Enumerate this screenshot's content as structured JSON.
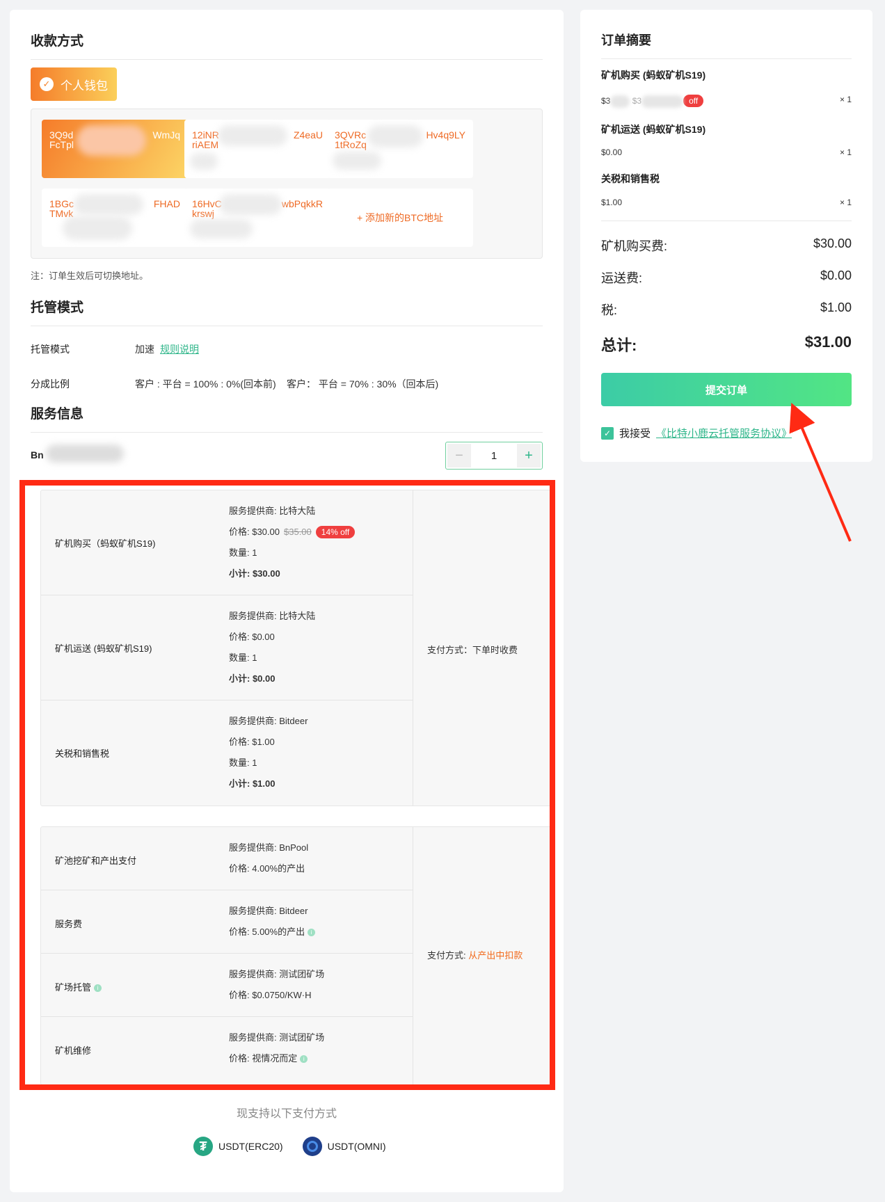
{
  "payment_method": {
    "title": "收款方式",
    "wallet_tab": "个人钱包",
    "addresses": [
      {
        "line1": "3Q9d",
        "line1_end": "WmJq",
        "line2": "FcTpl"
      },
      {
        "line1": "12iNR",
        "line1_end": "Z4eaU",
        "line2": "riAEM"
      },
      {
        "line1": "3QVRc",
        "line1_end": "Hv4q9LY",
        "line2": "1tRoZq"
      },
      {
        "line1": "1BGc",
        "line1_end": "FHAD",
        "line2": "TMvk"
      },
      {
        "line1": "16HvC",
        "line1_end": "wbPqkkR",
        "line2": "krswj"
      }
    ],
    "add_address": "+ 添加新的BTC地址",
    "note": "注：订单生效后可切换地址。"
  },
  "custody": {
    "title": "托管模式",
    "mode_label": "托管模式",
    "mode_value": "加速",
    "rules_link": "规则说明",
    "ratio_label": "分成比例",
    "ratio_before": "客户 : 平台 = 100% : 0%(回本前)",
    "ratio_after": "客户：  平台 = 70% : 30%（回本后)"
  },
  "service": {
    "title": "服务信息",
    "product_name": "Bn",
    "quantity": "1",
    "group1": {
      "payment": "支付方式：下单时收费",
      "rows": [
        {
          "name": "矿机购买（蚂蚁矿机S19)",
          "provider": "服务提供商: 比特大陆",
          "price": "价格: $30.00",
          "original": "$35.00",
          "badge": "14% off",
          "qty": "数量: 1",
          "subtotal": "小计: $30.00"
        },
        {
          "name": "矿机运送 (蚂蚁矿机S19)",
          "provider": "服务提供商: 比特大陆",
          "price": "价格: $0.00",
          "qty": "数量: 1",
          "subtotal": "小计: $0.00"
        },
        {
          "name": "关税和销售税",
          "provider": "服务提供商: Bitdeer",
          "price": "价格: $1.00",
          "qty": "数量: 1",
          "subtotal": "小计: $1.00"
        }
      ]
    },
    "group2": {
      "payment_label": "支付方式: ",
      "payment_value": "从产出中扣款",
      "rows": [
        {
          "name": "矿池挖矿和产出支付",
          "provider": "服务提供商: BnPool",
          "price": "价格: 4.00%的产出"
        },
        {
          "name": "服务费",
          "provider": "服务提供商: Bitdeer",
          "price": "价格: 5.00%的产出"
        },
        {
          "name": "矿场托管",
          "provider": "服务提供商: 测试团矿场",
          "price": "价格: $0.0750/KW·H"
        },
        {
          "name": "矿机维修",
          "provider": "服务提供商: 测试团矿场",
          "price": "价格: 视情况而定"
        }
      ]
    },
    "supported_title": "现支持以下支付方式",
    "methods": [
      "USDT(ERC20)",
      "USDT(OMNI)"
    ]
  },
  "summary": {
    "title": "订单摘要",
    "items": [
      {
        "title": "矿机购买 (蚂蚁矿机S19)",
        "price": "$3",
        "price2": "$3",
        "badge": "off",
        "qty": "× 1"
      },
      {
        "title": "矿机运送 (蚂蚁矿机S19)",
        "price": "$0.00",
        "qty": "× 1"
      },
      {
        "title": "关税和销售税",
        "price": "$1.00",
        "qty": "× 1"
      }
    ],
    "purchase_fee_label": "矿机购买费:",
    "purchase_fee": "$30.00",
    "shipping_label": "运送费:",
    "shipping": "$0.00",
    "tax_label": "税:",
    "tax": "$1.00",
    "total_label": "总计:",
    "total": "$31.00",
    "submit": "提交订单",
    "agree_text": "我接受",
    "agree_link": "《比特小鹿云托管服务协议》"
  }
}
